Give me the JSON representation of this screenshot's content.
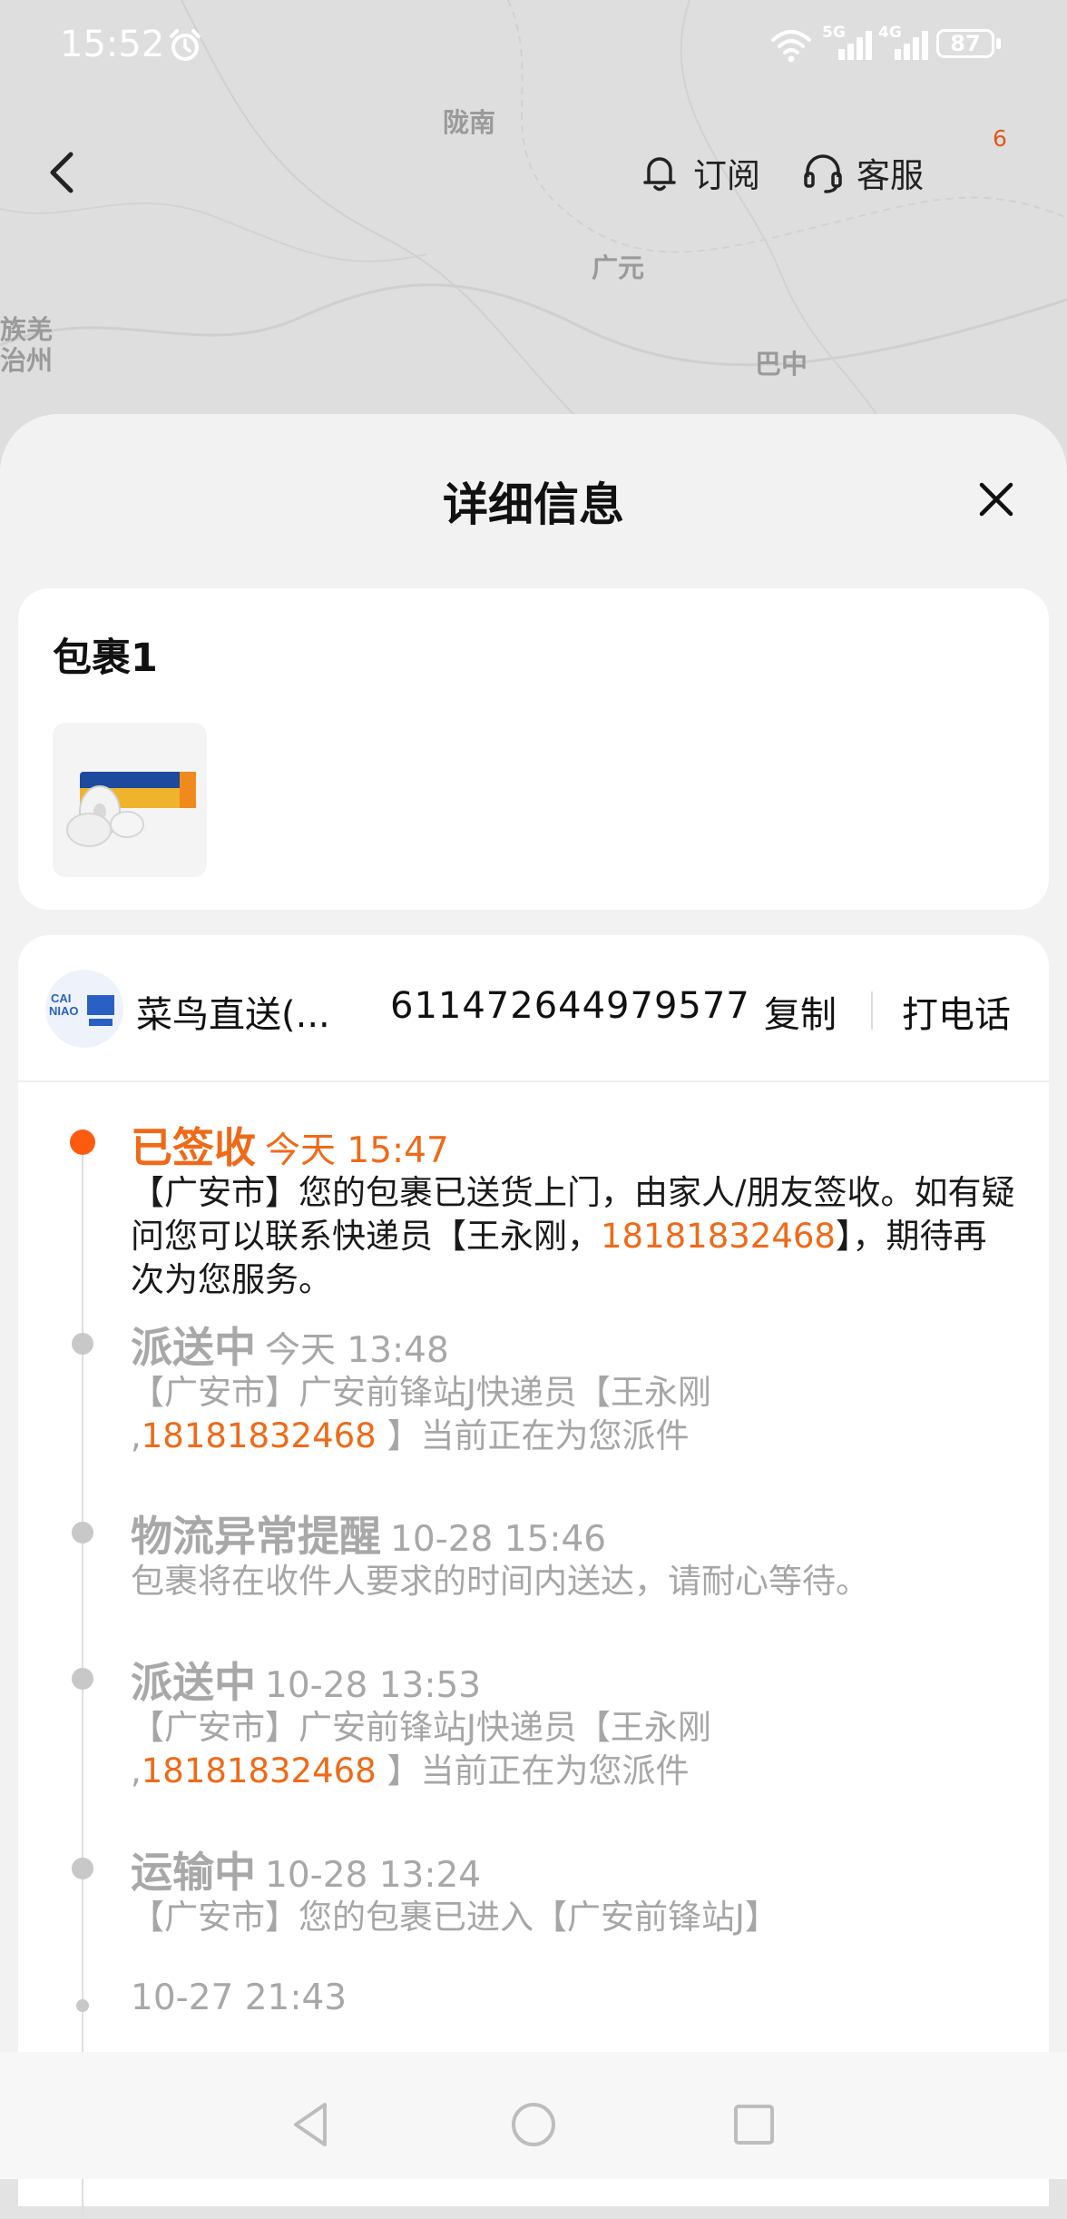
{
  "status_bar": {
    "time": "15:52",
    "signal1_label": "5G",
    "signal2_label": "4G",
    "battery": "87"
  },
  "map": {
    "labels": [
      "陇南",
      "广元",
      "巴中",
      "族羌",
      "治州"
    ]
  },
  "header": {
    "subscribe_label": "订阅",
    "service_label": "客服",
    "badge_count": "6"
  },
  "sheet": {
    "title": "详细信息",
    "package": {
      "title": "包裹1"
    },
    "courier": {
      "name": "菜鸟直送(...",
      "tracking_number": "611472644979577",
      "copy_label": "复制",
      "call_label": "打电话"
    },
    "events": [
      {
        "status": "已签收",
        "time": "今天 15:47",
        "desc_a": "【广安市】您的包裹已送货上门，由家人/朋友签收。如有疑问您可以联系快递员【王永刚，",
        "phone": "18181832468",
        "desc_b": "】，期待再次为您服务。"
      },
      {
        "status": "派送中",
        "time": "今天 13:48",
        "desc_a": "【广安市】广安前锋站J快递员【王永刚 ,",
        "phone": "18181832468",
        "desc_b": " 】当前正在为您派件"
      },
      {
        "status": "物流异常提醒",
        "time": "10-28 15:46",
        "desc_a": "包裹将在收件人要求的时间内送达，请耐心等待。"
      },
      {
        "status": "派送中",
        "time": "10-28 13:53",
        "desc_a": "【广安市】广安前锋站J快递员【王永刚 ,",
        "phone": "18181832468",
        "desc_b": " 】当前正在为您派件"
      },
      {
        "status": "运输中",
        "time": "10-28 13:24",
        "desc_a": "【广安市】您的包裹已进入【广安前锋站J】"
      },
      {
        "time": "10-27 21:43"
      }
    ]
  },
  "colors": {
    "accent": "#ef6a18",
    "active_dot": "#ff5b10",
    "muted": "#a8a8a8"
  }
}
